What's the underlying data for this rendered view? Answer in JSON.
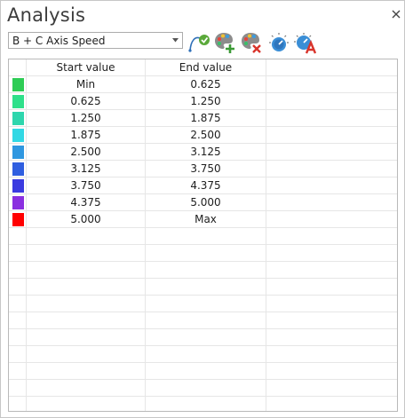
{
  "window": {
    "title": "Analysis"
  },
  "toolbar": {
    "axis_select": {
      "value": "B + C Axis Speed"
    },
    "buttons": [
      {
        "name": "apply-analysis-button",
        "icon": "curve-check-icon"
      },
      {
        "name": "add-color-button",
        "icon": "palette-plus-icon"
      },
      {
        "name": "remove-color-button",
        "icon": "palette-x-icon"
      },
      {
        "name": "range-dial-button",
        "icon": "dial-icon"
      },
      {
        "name": "auto-range-button",
        "icon": "dial-a-icon"
      }
    ]
  },
  "table": {
    "headers": {
      "start": "Start value",
      "end": "End value"
    },
    "rows": [
      {
        "color": "#2ecc55",
        "start": "Min",
        "end": "0.625"
      },
      {
        "color": "#2fe08a",
        "start": "0.625",
        "end": "1.250"
      },
      {
        "color": "#2ed6ad",
        "start": "1.250",
        "end": "1.875"
      },
      {
        "color": "#31d8e4",
        "start": "1.875",
        "end": "2.500"
      },
      {
        "color": "#2f97e0",
        "start": "2.500",
        "end": "3.125"
      },
      {
        "color": "#2f5ee0",
        "start": "3.125",
        "end": "3.750"
      },
      {
        "color": "#3a3ae0",
        "start": "3.750",
        "end": "4.375"
      },
      {
        "color": "#8a2fe0",
        "start": "4.375",
        "end": "5.000"
      },
      {
        "color": "#ff0000",
        "start": "5.000",
        "end": "Max"
      }
    ],
    "empty_rows": 11
  }
}
